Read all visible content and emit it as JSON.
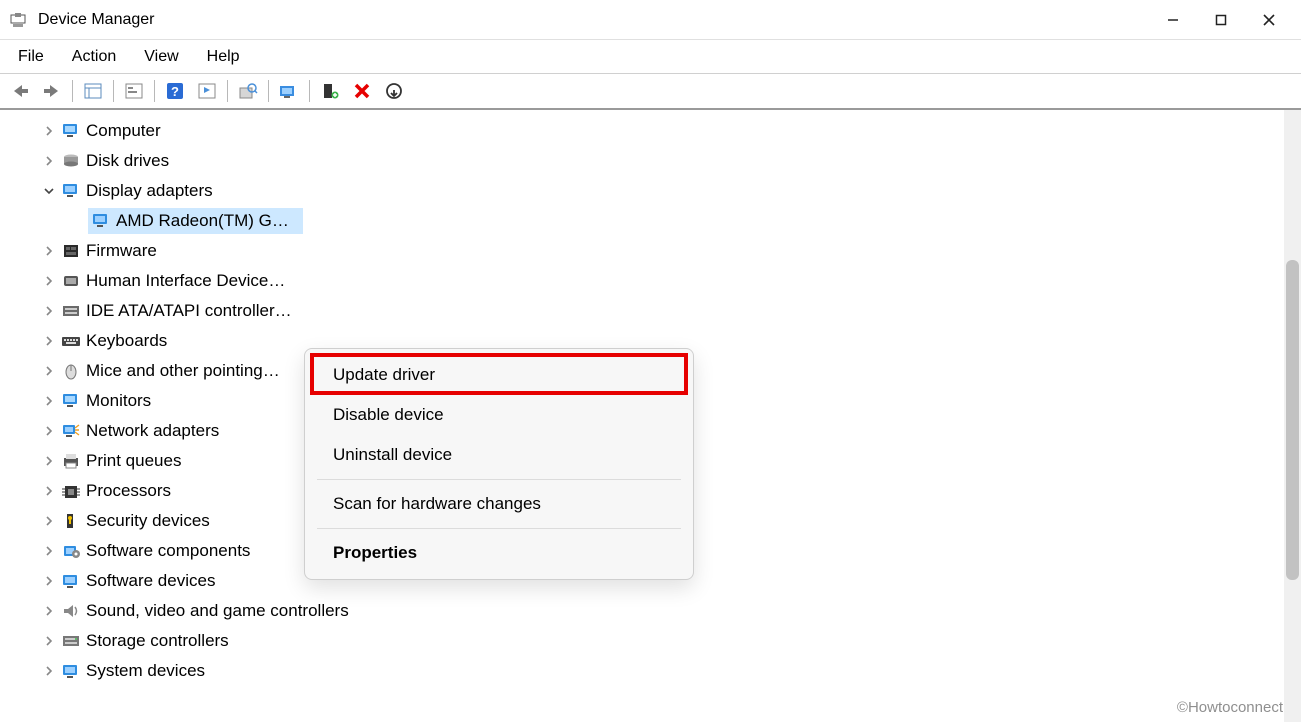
{
  "window": {
    "title": "Device Manager"
  },
  "menubar": {
    "items": [
      "File",
      "Action",
      "View",
      "Help"
    ]
  },
  "toolbar": {
    "buttons": [
      {
        "name": "back-icon"
      },
      {
        "name": "forward-icon"
      },
      {
        "sep": true
      },
      {
        "name": "details-view-icon"
      },
      {
        "sep": true
      },
      {
        "name": "properties-panel-icon"
      },
      {
        "sep": true
      },
      {
        "name": "help-icon"
      },
      {
        "name": "devices-by-type-icon"
      },
      {
        "sep": true
      },
      {
        "name": "scan-hardware-icon"
      },
      {
        "sep": true
      },
      {
        "name": "update-driver-icon"
      },
      {
        "sep": true
      },
      {
        "name": "add-legacy-icon"
      },
      {
        "name": "uninstall-device-icon"
      },
      {
        "name": "disable-device-circle-icon"
      }
    ]
  },
  "tree": {
    "nodes": [
      {
        "label": "Computer",
        "icon": "monitor",
        "expander": "right"
      },
      {
        "label": "Disk drives",
        "icon": "disk",
        "expander": "right"
      },
      {
        "label": "Display adapters",
        "icon": "display",
        "expander": "down",
        "children": [
          {
            "label": "AMD Radeon(TM) G…",
            "icon": "display",
            "selected": true
          }
        ]
      },
      {
        "label": "Firmware",
        "icon": "firmware",
        "expander": "right"
      },
      {
        "label": "Human Interface Device…",
        "icon": "hid",
        "expander": "right"
      },
      {
        "label": "IDE ATA/ATAPI controller…",
        "icon": "ide",
        "expander": "right"
      },
      {
        "label": "Keyboards",
        "icon": "keyboard",
        "expander": "right"
      },
      {
        "label": "Mice and other pointing…",
        "icon": "mouse",
        "expander": "right"
      },
      {
        "label": "Monitors",
        "icon": "monitor",
        "expander": "right"
      },
      {
        "label": "Network adapters",
        "icon": "network",
        "expander": "right"
      },
      {
        "label": "Print queues",
        "icon": "printer",
        "expander": "right"
      },
      {
        "label": "Processors",
        "icon": "cpu",
        "expander": "right"
      },
      {
        "label": "Security devices",
        "icon": "security",
        "expander": "right"
      },
      {
        "label": "Software components",
        "icon": "softcomp",
        "expander": "right"
      },
      {
        "label": "Software devices",
        "icon": "softdev",
        "expander": "right"
      },
      {
        "label": "Sound, video and game controllers",
        "icon": "sound",
        "expander": "right"
      },
      {
        "label": "Storage controllers",
        "icon": "storage",
        "expander": "right"
      },
      {
        "label": "System devices",
        "icon": "system",
        "expander": "right"
      }
    ]
  },
  "context_menu": {
    "items": [
      {
        "label": "Update driver",
        "highlighted": true
      },
      {
        "label": "Disable device"
      },
      {
        "label": "Uninstall device"
      },
      {
        "sep": true
      },
      {
        "label": "Scan for hardware changes"
      },
      {
        "sep": true
      },
      {
        "label": "Properties",
        "bold": true
      }
    ]
  },
  "watermark": "©Howtoconnect"
}
